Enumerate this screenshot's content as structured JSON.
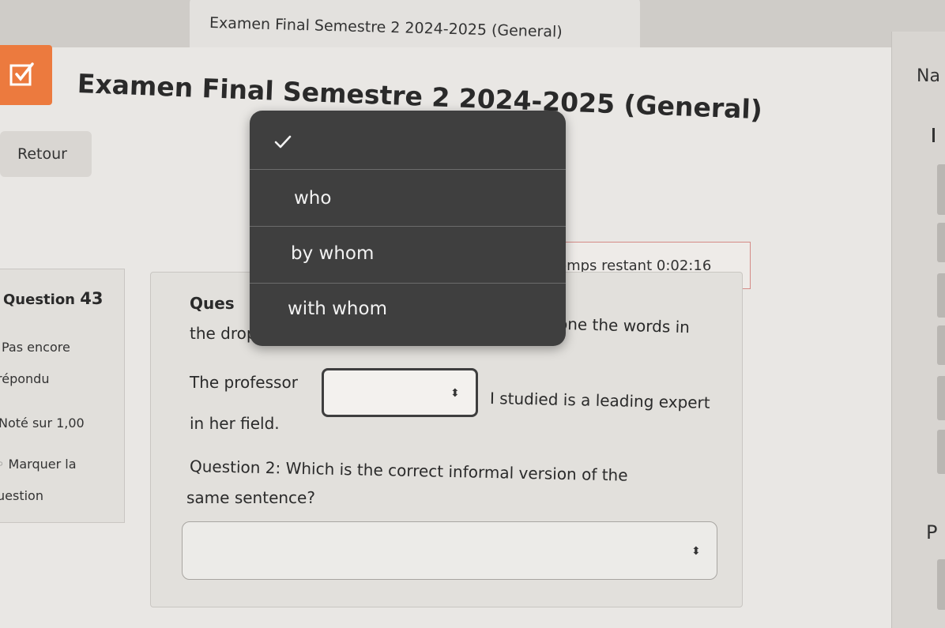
{
  "browser": {
    "tab_title": "Examen Final Semestre 2 2024-2025 (General)"
  },
  "right_panel": {
    "nav_fragment": "Na",
    "bottom_fragment": "P"
  },
  "course": {
    "title": "Examen Final Semestre 2 2024-2025 (General)",
    "icon": "checkbox-icon",
    "accent_color": "#ec7a3e"
  },
  "retour_label": "Retour",
  "timer": {
    "label": "emps restant",
    "value": "0:02:16"
  },
  "question_info": {
    "label": "Question",
    "number": "43",
    "status_line1": "Pas encore",
    "status_line2": "répondu",
    "grade": "Noté sur 1,00",
    "flag_line1": "Marquer la",
    "flag_line2": "uestion"
  },
  "question": {
    "intro_left": "Ques",
    "intro_right": "one the words in",
    "intro_line2": "the drop-down list.",
    "sentence_before": "The professor",
    "sentence_after": "I studied is a leading expert",
    "sentence_line2": "in her field.",
    "q2_line1": "Question 2: Which is the correct informal version of the",
    "q2_line2": "same sentence?",
    "select_arrow": "⬍",
    "select_selected": "",
    "wide_select_selected": ""
  },
  "dropdown": {
    "options": [
      {
        "label": "",
        "checked": true
      },
      {
        "label": "who",
        "checked": false
      },
      {
        "label": "by whom",
        "checked": false
      },
      {
        "label": "with whom",
        "checked": false
      }
    ]
  }
}
